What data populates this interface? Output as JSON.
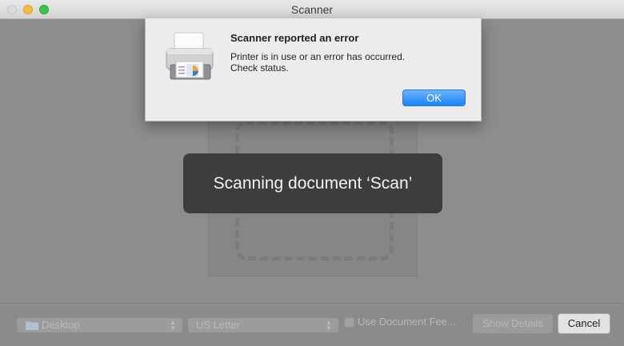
{
  "window": {
    "title": "Scanner"
  },
  "dialog": {
    "title": "Scanner reported an error",
    "message_line1": "Printer is in use or an error has occurred.",
    "message_line2": "Check status.",
    "ok_label": "OK",
    "icon": "printer-icon"
  },
  "hud": {
    "text": "Scanning document ‘Scan’"
  },
  "bottom": {
    "location": {
      "value": "Desktop",
      "icon": "folder-icon"
    },
    "paper_size": {
      "value": "US Letter"
    },
    "document_feeder": {
      "label": "Use Document Fee...",
      "checked": false
    },
    "show_details_label": "Show Details",
    "cancel_label": "Cancel"
  },
  "colors": {
    "accent": "#1a82fb",
    "hud_bg": "#3c3d3e",
    "dim_bg": "#8c8d8e"
  }
}
